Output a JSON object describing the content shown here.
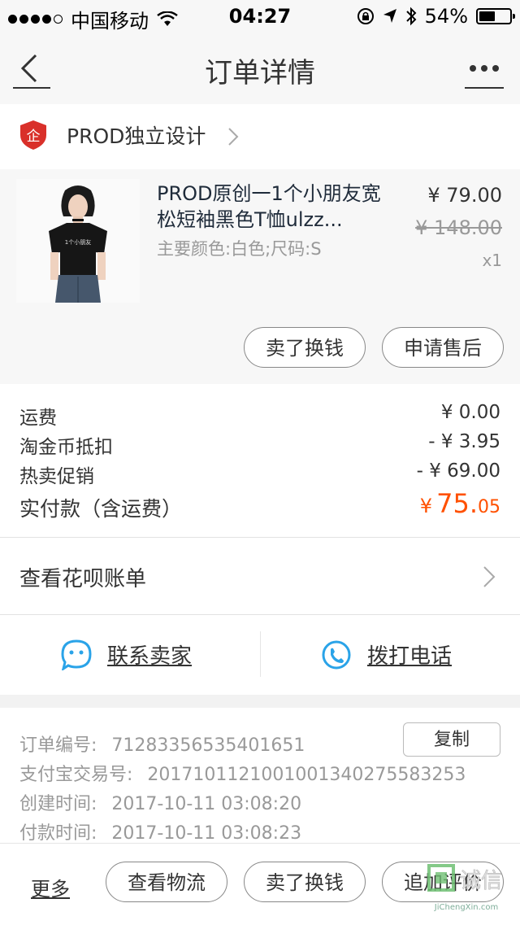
{
  "status_bar": {
    "carrier": "中国移动",
    "time": "04:27",
    "battery_percent": "54%",
    "battery_level": 0.54,
    "signal_bars": 4,
    "icons": [
      "wifi-icon",
      "orientation-lock-icon",
      "location-icon",
      "bluetooth-icon",
      "battery-icon"
    ]
  },
  "nav": {
    "title": "订单详情",
    "back_icon": "back-chevron-icon",
    "more_icon": "more-dots-icon"
  },
  "shop": {
    "logo_text": "企",
    "name": "PROD独立设计"
  },
  "item": {
    "title": "PROD原创一1个小朋友宽松短袖黑色T恤ulzz...",
    "spec": "主要颜色:白色;尺码:S",
    "price": "¥ 79.00",
    "original_price": "¥ 148.00",
    "quantity": "x1",
    "shirt_print": "1个小朋友",
    "actions": [
      "卖了换钱",
      "申请售后"
    ]
  },
  "fees": {
    "rows": [
      {
        "label": "运费",
        "value": "¥ 0.00"
      },
      {
        "label": "淘金币抵扣",
        "value": "- ¥ 3.95"
      },
      {
        "label": "热卖促销",
        "value": "- ¥ 69.00"
      }
    ],
    "paid_label": "实付款（含运费）",
    "paid_currency": "¥",
    "paid_int": "75.",
    "paid_dec": "05"
  },
  "huabei": {
    "label": "查看花呗账单"
  },
  "contact": {
    "seller_label": "联系卖家",
    "call_label": "拨打电话"
  },
  "order_info": {
    "rows": [
      {
        "label": "订单编号:",
        "value": "71283356535401651"
      },
      {
        "label": "支付宝交易号:",
        "value": "2017101121001001340275583253"
      },
      {
        "label": "创建时间:",
        "value": "2017-10-11 03:08:20"
      },
      {
        "label": "付款时间:",
        "value": "2017-10-11 03:08:23"
      }
    ],
    "copy_label": "复制"
  },
  "bottom_bar": {
    "more_label": "更多",
    "buttons": [
      "查看物流",
      "卖了换钱",
      "追加评价"
    ]
  },
  "watermark": {
    "glyphs": "诚信",
    "url": "JiChengXin.com"
  },
  "colors": {
    "accent": "#ff5000",
    "contact_blue": "#2aa3e8",
    "shop_logo_red": "#d9302a"
  }
}
